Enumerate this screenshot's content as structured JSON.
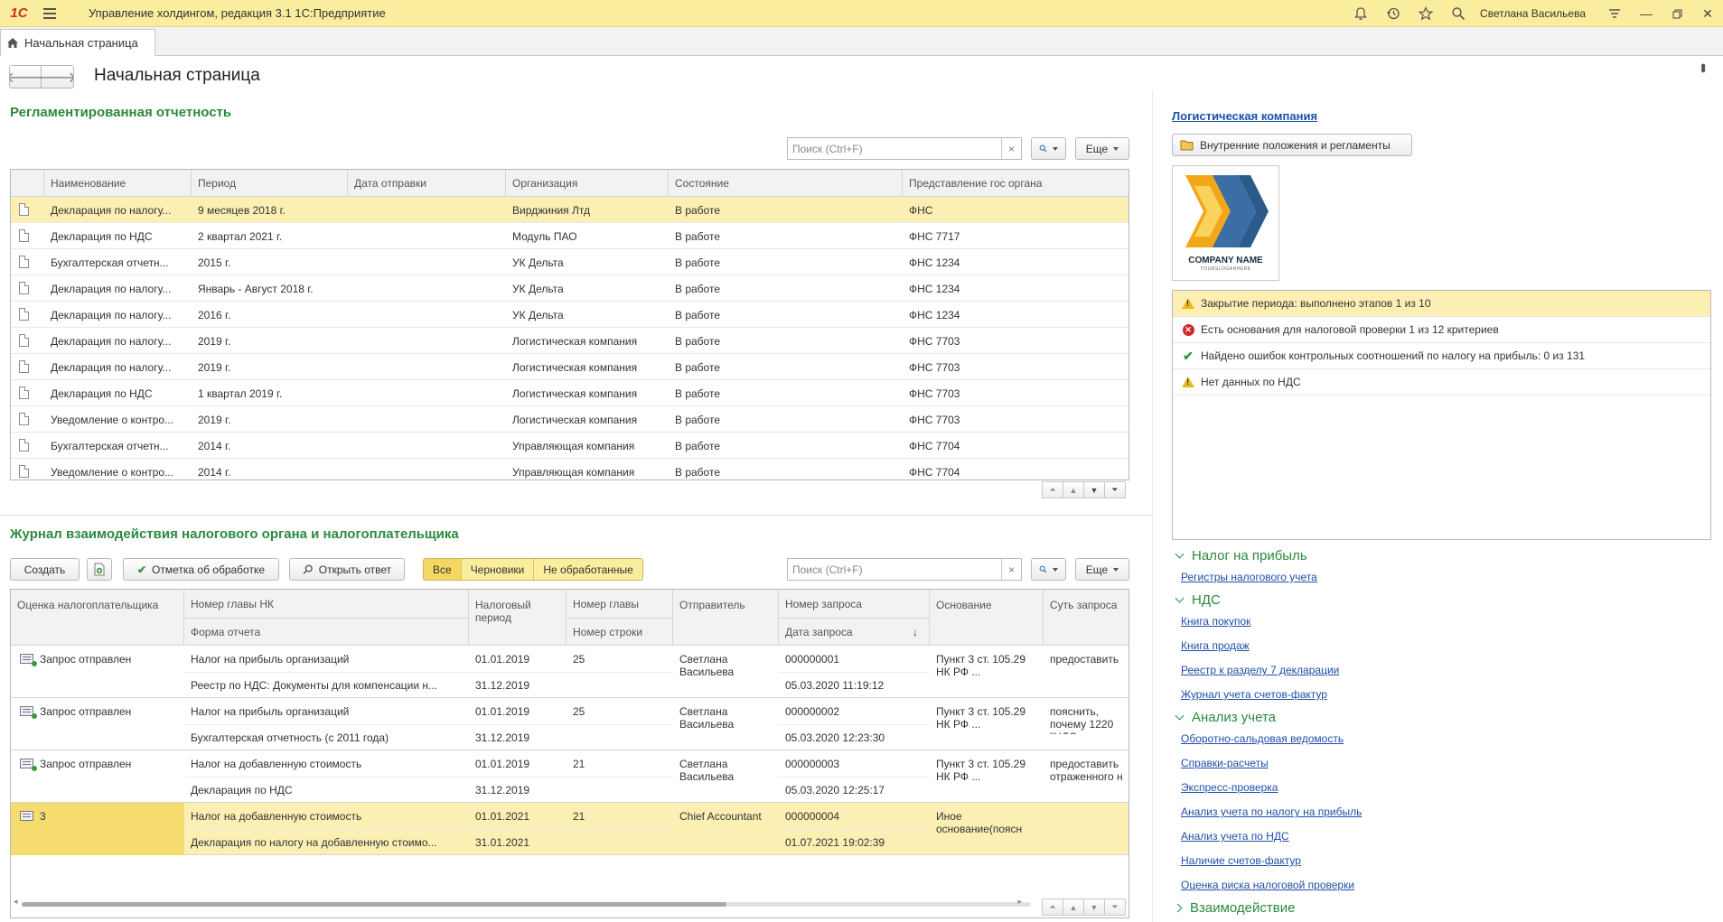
{
  "titlebar": {
    "logo": "1С",
    "title": "Управление холдингом, редакция 3.1 1С:Предприятие",
    "user": "Светлана Васильева"
  },
  "tabs": {
    "home": "Начальная страница"
  },
  "page": {
    "title": "Начальная страница"
  },
  "reports": {
    "title": "Регламентированная отчетность",
    "search_placeholder": "Поиск (Ctrl+F)",
    "more": "Еще",
    "columns": [
      "Наименование",
      "Период",
      "Дата отправки",
      "Организация",
      "Состояние",
      "Представление гос органа"
    ],
    "rows": [
      [
        "Декларация по налогу...",
        "9 месяцев 2018 г.",
        "",
        "Вирджиния Лтд",
        "В работе",
        "ФНС"
      ],
      [
        "Декларация по НДС",
        "2 квартал 2021 г.",
        "",
        "Модуль ПАО",
        "В работе",
        "ФНС 7717"
      ],
      [
        "Бухгалтерская отчетн...",
        "2015 г.",
        "",
        "УК Дельта",
        "В работе",
        "ФНС 1234"
      ],
      [
        "Декларация по налогу...",
        "Январь - Август 2018 г.",
        "",
        "УК Дельта",
        "В работе",
        "ФНС 1234"
      ],
      [
        "Декларация по налогу...",
        "2016 г.",
        "",
        "УК Дельта",
        "В работе",
        "ФНС 1234"
      ],
      [
        "Декларация по налогу...",
        "2019 г.",
        "",
        "Логистическая компания",
        "В работе",
        "ФНС 7703"
      ],
      [
        "Декларация по налогу...",
        "2019 г.",
        "",
        "Логистическая компания",
        "В работе",
        "ФНС 7703"
      ],
      [
        "Декларация по НДС",
        "1 квартал 2019 г.",
        "",
        "Логистическая компания",
        "В работе",
        "ФНС 7703"
      ],
      [
        "Уведомление о контро...",
        "2019 г.",
        "",
        "Логистическая компания",
        "В работе",
        "ФНС 7703"
      ],
      [
        "Бухгалтерская отчетн...",
        "2014 г.",
        "",
        "Управляющая компания",
        "В работе",
        "ФНС 7704"
      ],
      [
        "Уведомление о контро...",
        "2014 г.",
        "",
        "Управляющая компания",
        "В работе",
        "ФНС 7704"
      ]
    ]
  },
  "journal": {
    "title": "Журнал взаимодействия налогового органа и налогоплательщика",
    "create": "Создать",
    "mark_processed": "Отметка об обработке",
    "open_answer": "Открыть ответ",
    "filters": [
      "Все",
      "Черновики",
      "Не обработанные"
    ],
    "search_placeholder": "Поиск (Ctrl+F)",
    "more": "Еще",
    "columns": {
      "assessment": "Оценка налогоплательщика",
      "chapter": "Номер главы НК",
      "form": "Форма отчета",
      "period": "Налоговый период",
      "chapter_no": "Номер главы",
      "line_no": "Номер строки",
      "sender": "Отправитель",
      "req_no": "Номер запроса",
      "req_date": "Дата запроса",
      "basis": "Основание",
      "essence": "Суть запроса"
    },
    "rows": [
      {
        "assessment": "Запрос отправлен",
        "chapter": "Налог на прибыль организаций",
        "form": "Реестр по НДС: Документы для компенсации н...",
        "period1": "01.01.2019",
        "period2": "31.12.2019",
        "chapter_no": "25",
        "sender": "Светлана Васильева",
        "req_no": "000000001",
        "req_date": "05.03.2020 11:19:12",
        "basis": "Пункт 3 ст. 105.29 НК РФ ...",
        "essence": "предоставить"
      },
      {
        "assessment": "Запрос отправлен",
        "chapter": "Налог на прибыль организаций",
        "form": "Бухгалтерская отчетность (с 2011 года)",
        "period1": "01.01.2019",
        "period2": "31.12.2019",
        "chapter_no": "25",
        "sender": "Светлана Васильева",
        "req_no": "000000002",
        "req_date": "05.03.2020 12:23:30",
        "basis": "Пункт 3 ст. 105.29 НК РФ ...",
        "essence": "пояснить, почему 1220 \"НДС по"
      },
      {
        "assessment": "Запрос отправлен",
        "chapter": "Налог на добавленную стоимость",
        "form": "Декларация по НДС",
        "period1": "01.01.2019",
        "period2": "31.12.2019",
        "chapter_no": "21",
        "sender": "Светлана Васильева",
        "req_no": "000000003",
        "req_date": "05.03.2020 12:25:17",
        "basis": "Пункт 3 ст. 105.29 НК РФ ...",
        "essence": "предоставить отраженного н"
      },
      {
        "assessment": "3",
        "chapter": "Налог на добавленную стоимость",
        "form": "Декларация по налогу на добавленную стоимо...",
        "period1": "01.01.2021",
        "period2": "31.01.2021",
        "chapter_no": "21",
        "sender": "Chief Accountant",
        "req_no": "000000004",
        "req_date": "01.07.2021 19:02:39",
        "basis": "Иное основание(поясн",
        "essence": ""
      }
    ]
  },
  "right": {
    "company_link": "Логистическая компания",
    "internal_btn": "Внутренние положения и регламенты",
    "logo_name": "COMPANY NAME",
    "logo_slogan": "YOURSLOGANHERE",
    "statuses": [
      {
        "type": "warn",
        "text": "Закрытие периода: выполнено этапов 1 из 10"
      },
      {
        "type": "err",
        "text": "Есть основания для налоговой проверки 1 из 12 критериев"
      },
      {
        "type": "ok",
        "text": "Найдено ошибок контрольных соотношений по налогу на прибыль: 0 из 131"
      },
      {
        "type": "warn",
        "text": "Нет данных по НДС"
      }
    ],
    "groups": {
      "profit": {
        "title": "Налог на прибыль",
        "links": [
          "Регистры налогового учета"
        ]
      },
      "vat": {
        "title": "НДС",
        "links": [
          "Книга покупок",
          "Книга продаж",
          "Реестр к разделу 7 декларации",
          "Журнал учета счетов-фактур"
        ]
      },
      "analysis": {
        "title": "Анализ учета",
        "links": [
          "Оборотно-сальдовая ведомость",
          "Справки-расчеты",
          "Экспресс-проверка",
          "Анализ учета по налогу на прибыль",
          "Анализ учета по НДС",
          "Наличие счетов-фактур",
          "Оценка риска налоговой проверки"
        ]
      },
      "interaction": {
        "title": "Взаимодействие"
      }
    }
  },
  "colors": {
    "accent_green": "#2a8a3e",
    "titlebar": "#fbed9e",
    "selection": "#fcefb4",
    "link": "#1f4fa8"
  }
}
